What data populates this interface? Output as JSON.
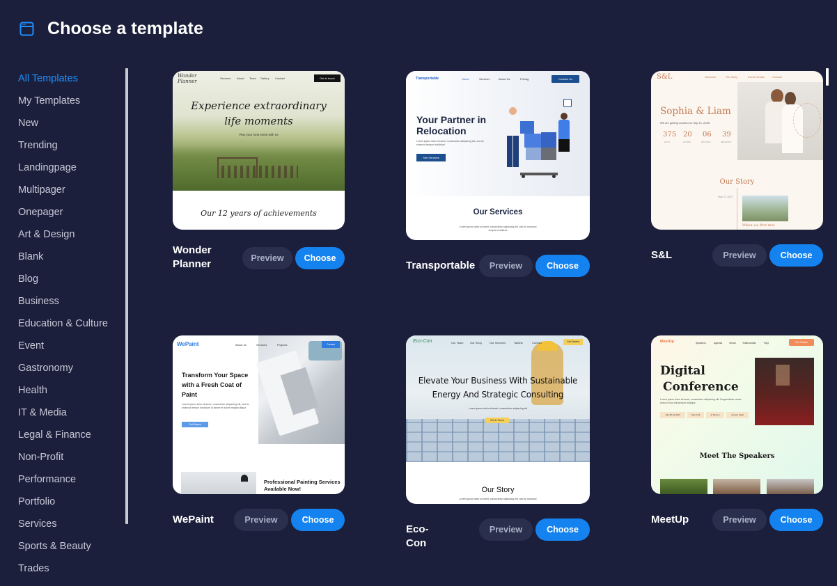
{
  "header": {
    "title": "Choose a template",
    "icon": "browser-window-icon"
  },
  "sidebar": {
    "items": [
      {
        "label": "All Templates",
        "active": true
      },
      {
        "label": "My Templates"
      },
      {
        "label": "New"
      },
      {
        "label": "Trending"
      },
      {
        "label": "Landingpage"
      },
      {
        "label": "Multipager"
      },
      {
        "label": "Onepager"
      },
      {
        "label": "Art & Design"
      },
      {
        "label": "Blank"
      },
      {
        "label": "Blog"
      },
      {
        "label": "Business"
      },
      {
        "label": "Education & Culture"
      },
      {
        "label": "Event"
      },
      {
        "label": "Gastronomy"
      },
      {
        "label": "Health"
      },
      {
        "label": "IT & Media"
      },
      {
        "label": "Legal & Finance"
      },
      {
        "label": "Non-Profit"
      },
      {
        "label": "Performance"
      },
      {
        "label": "Portfolio"
      },
      {
        "label": "Services"
      },
      {
        "label": "Sports & Beauty"
      },
      {
        "label": "Trades"
      }
    ]
  },
  "buttons": {
    "preview": "Preview",
    "choose": "Choose"
  },
  "templates": {
    "wonder": {
      "name": "Wonder Planner",
      "logo": "Wonder Planner",
      "nav": [
        "Services",
        "About",
        "Team",
        "Gallery",
        "Contact"
      ],
      "cta": "Get in touch",
      "headline1": "Experience extraordinary",
      "headline2": "life moments",
      "sub": "Plan your next event with us",
      "footer": "Our 12 years of achievements"
    },
    "transportable": {
      "name": "Transportable",
      "logo": "Transportable",
      "nav": [
        "Home",
        "Services",
        "About Us",
        "Pricing"
      ],
      "cta": "Contact Us",
      "headline1": "Your Partner in",
      "headline2": "Relocation",
      "body": "Lorem ipsum dolor sit amet, consectetur adipiscing elit, sed do eiusmod tempor incididunt",
      "button": "See Services",
      "section": "Our Services",
      "section_body": "Lorem ipsum dolor sit amet, consectetur adipiscing elit, sed do eiusmod tempor incididunt"
    },
    "sl": {
      "name": "S&L",
      "logo": "S&L",
      "nav": [
        "Welcome",
        "Our Story",
        "Event Details",
        "Contact"
      ],
      "couple": "Sophia & Liam",
      "sub": "We are getting married on Sep 21, 2025",
      "countdown": [
        {
          "value": "375",
          "unit": "DAYS"
        },
        {
          "value": "20",
          "unit": "HOURS"
        },
        {
          "value": "06",
          "unit": "MINUTES"
        },
        {
          "value": "39",
          "unit": "SECONDS"
        }
      ],
      "section": "Our Story",
      "date": "May 21, 2023",
      "caption": "When we first met"
    },
    "wepaint": {
      "name": "WePaint",
      "logo": "WePaint",
      "nav": [
        "About us",
        "Services",
        "Projects"
      ],
      "cta": "Contact",
      "headline": "Transform Your Space with a Fresh Coat of Paint",
      "body": "Lorem ipsum dolor sit amet, consectetur adipiscing elit, sed do eiusmod tempor incididunt ut labore et dolore magna aliqua",
      "button": "Get Started",
      "section": "Professional Painting Services Available Now!"
    },
    "ecocon": {
      "name": "Eco-Con",
      "logo": "Eco-Con",
      "nav": [
        "Our Team",
        "Our Story",
        "Our Services",
        "Tablets",
        "Contact"
      ],
      "cta": "Get Started",
      "headline1": "Elevate Your Business With Sustainable",
      "headline2": "Energy And Strategic Consulting",
      "body": "Lorem ipsum dolor sit amet, consectetur adipiscing elit",
      "button": "Get In Touch",
      "section": "Our Story",
      "section_body": "Lorem ipsum dolor sit amet, consectetur adipiscing elit, sed do eiusmod"
    },
    "meetup": {
      "name": "MeetUp",
      "logo": "MeetUp",
      "nav": [
        "Speakers",
        "Agenda",
        "Venue",
        "Testimonials",
        "FAQ"
      ],
      "cta": "Get Tickets",
      "headline1": "Digital",
      "headline2": "Conference",
      "body": "Lorem ipsum dolor sit amet, consectetur adipiscing elit. Suspendisse varius enim in eros elementum tristique.",
      "tags": [
        "July 28-31 2024",
        "New York",
        "In Person",
        "Access Initial"
      ],
      "section": "Meet The Speakers"
    }
  },
  "colors": {
    "background": "#1b1f3b",
    "accent": "#1583ef",
    "preview_button": "#2a2f4d"
  }
}
